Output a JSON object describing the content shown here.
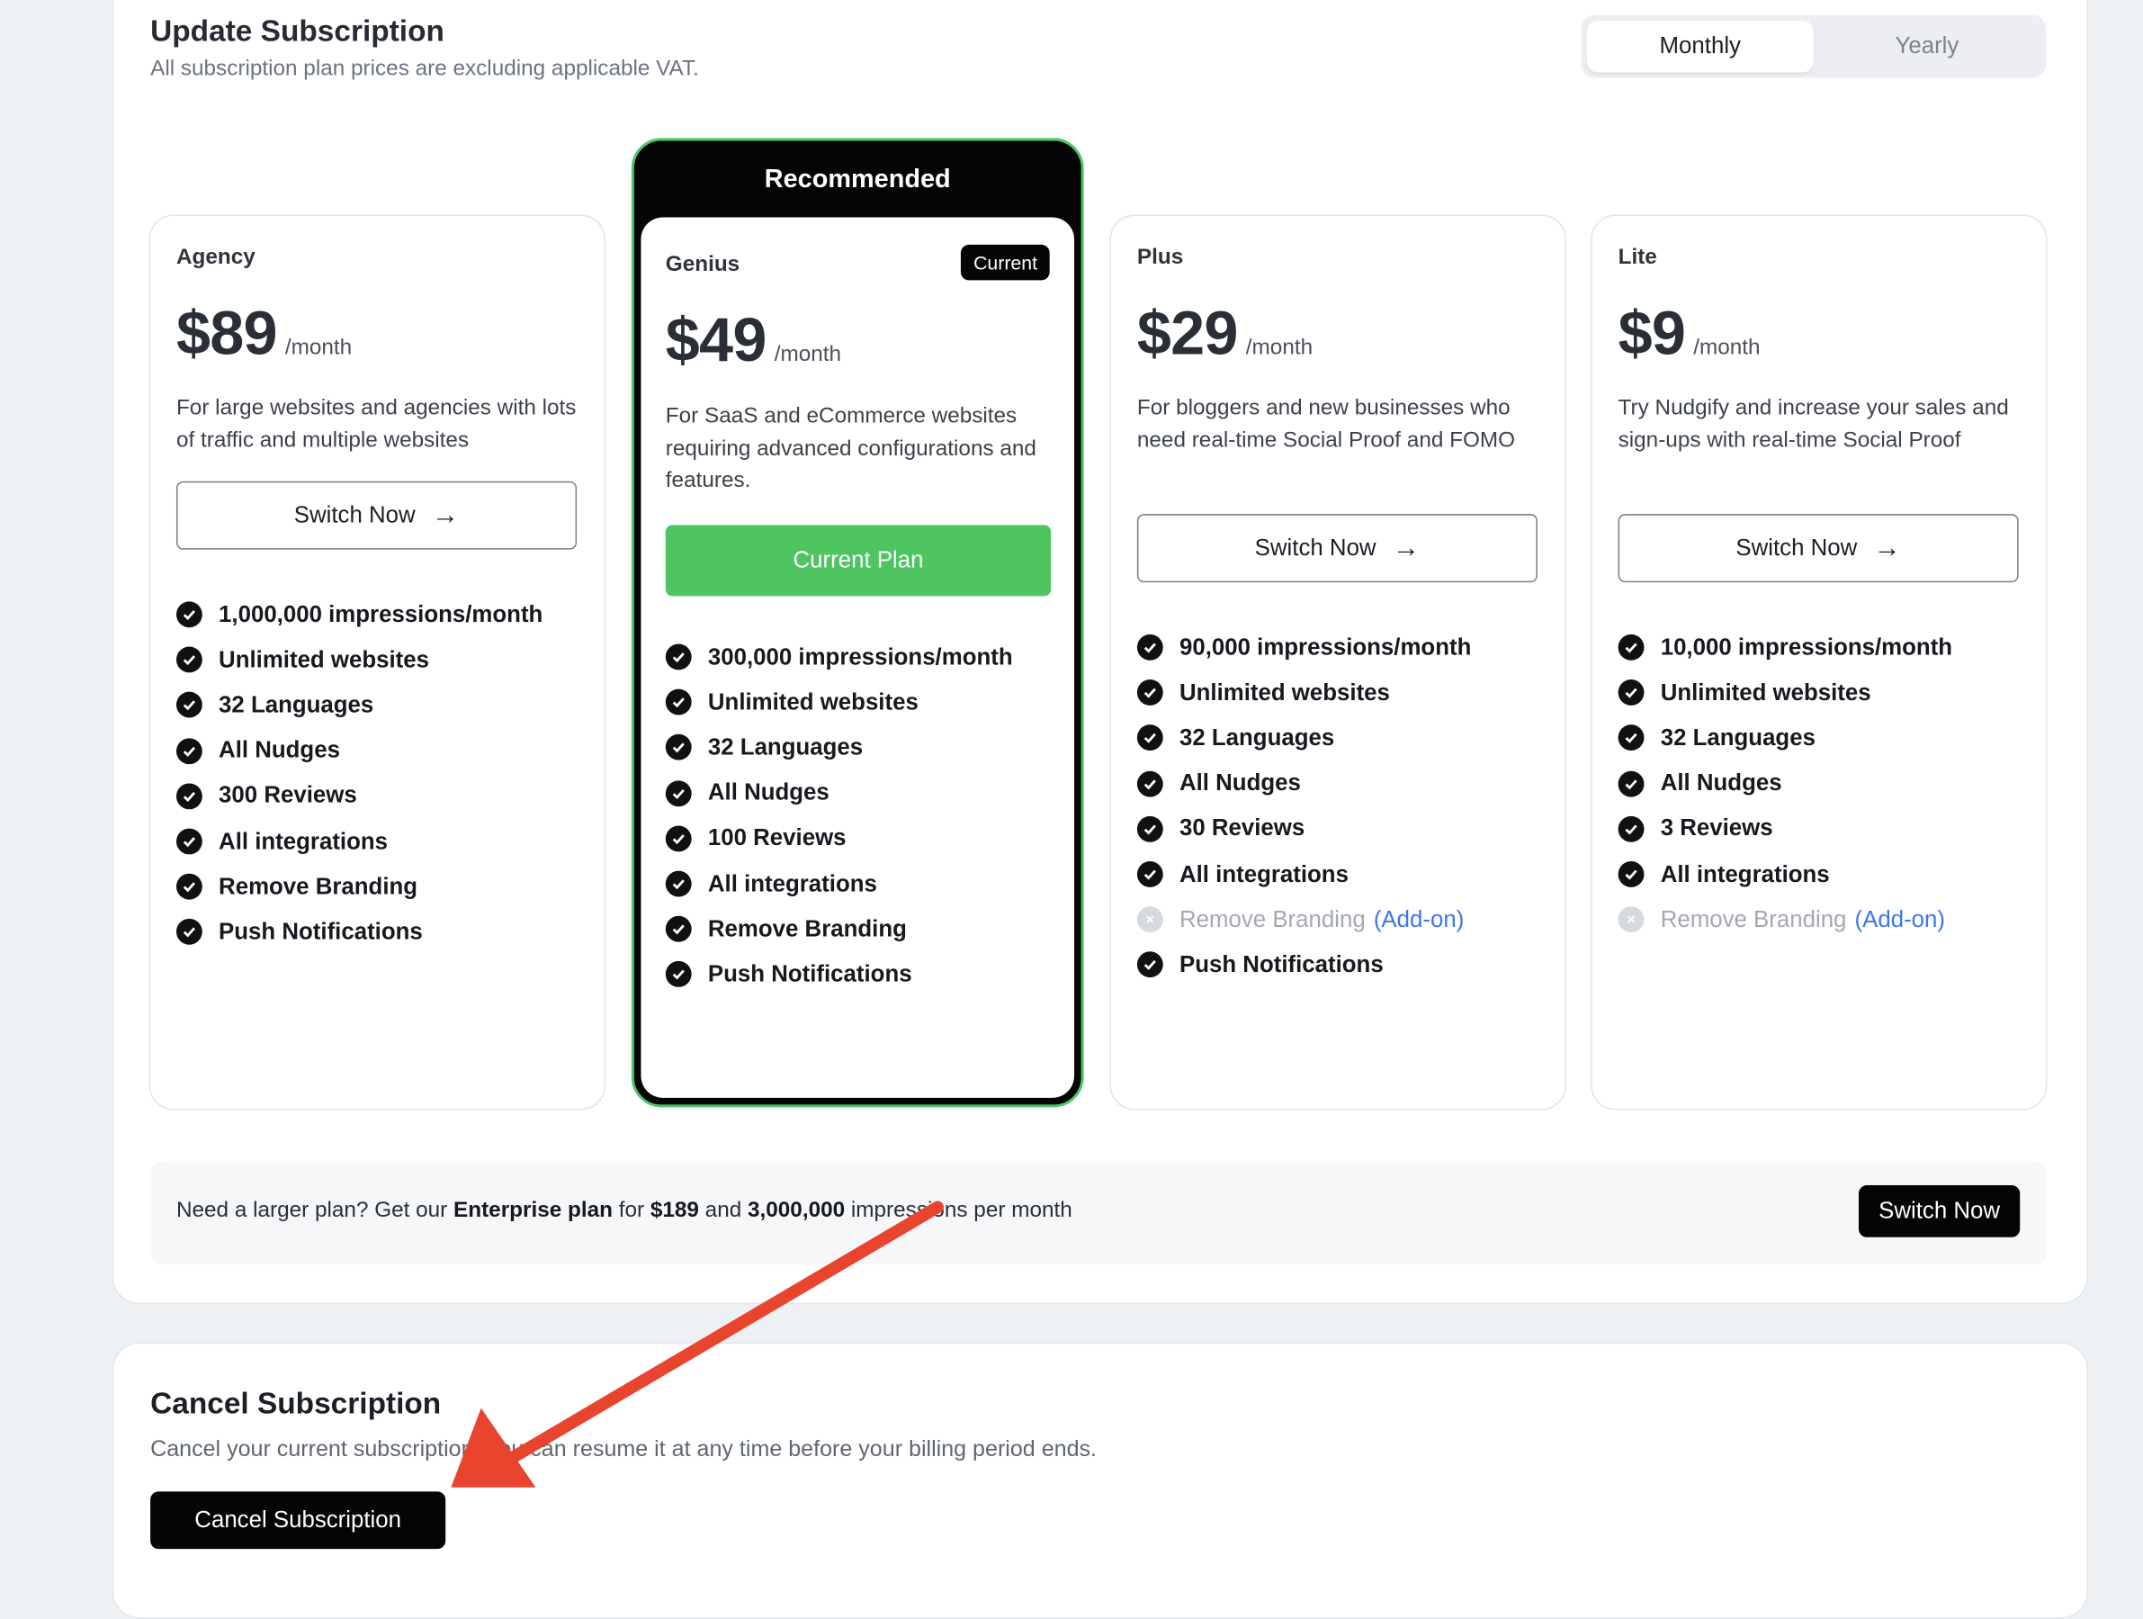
{
  "update": {
    "title": "Update Subscription",
    "subtitle": "All subscription plan prices are excluding applicable VAT.",
    "billing_toggle": {
      "monthly": "Monthly",
      "yearly": "Yearly",
      "selected": "Monthly"
    }
  },
  "plans": {
    "agency": {
      "name": "Agency",
      "price": "$89",
      "period": "/month",
      "description": "For large websites and agencies with lots of traffic and multiple websites",
      "button": "Switch Now",
      "features": [
        "1,000,000 impressions/month",
        "Unlimited websites",
        "32 Languages",
        "All Nudges",
        "300 Reviews",
        "All integrations",
        "Remove Branding",
        "Push Notifications"
      ]
    },
    "genius": {
      "ribbon": "Recommended",
      "name": "Genius",
      "badge": "Current",
      "price": "$49",
      "period": "/month",
      "description": "For SaaS and eCommerce websites requiring advanced configurations and features.",
      "button": "Current Plan",
      "features": [
        "300,000 impressions/month",
        "Unlimited websites",
        "32 Languages",
        "All Nudges",
        "100 Reviews",
        "All integrations",
        "Remove Branding",
        "Push Notifications"
      ]
    },
    "plus": {
      "name": "Plus",
      "price": "$29",
      "period": "/month",
      "description": "For bloggers and new businesses who need real-time Social Proof and FOMO",
      "button": "Switch Now",
      "features": [
        "90,000 impressions/month",
        "Unlimited websites",
        "32 Languages",
        "All Nudges",
        "30 Reviews",
        "All integrations"
      ],
      "disabled_feature": "Remove Branding",
      "addon_label": "(Add-on)",
      "last_feature": "Push Notifications"
    },
    "lite": {
      "name": "Lite",
      "price": "$9",
      "period": "/month",
      "description": "Try Nudgify and increase your sales and sign-ups with real-time Social Proof",
      "button": "Switch Now",
      "features": [
        "10,000 impressions/month",
        "Unlimited websites",
        "32 Languages",
        "All Nudges",
        "3 Reviews",
        "All integrations"
      ],
      "disabled_feature": "Remove Branding",
      "addon_label": "(Add-on)"
    }
  },
  "enterprise": {
    "prefix": "Need a larger plan? Get our ",
    "plan_name": "Enterprise plan",
    "mid": " for ",
    "price": "$189",
    "and": " and ",
    "impressions": "3,000,000",
    "suffix": " impressions per month",
    "button": "Switch Now"
  },
  "cancel": {
    "title": "Cancel Subscription",
    "subtitle": "Cancel your current subscription. You can resume it at any time before your billing period ends.",
    "button": "Cancel Subscription"
  },
  "annotation": {
    "arrow_color": "#e8442e"
  },
  "colors": {
    "accent_green": "#4fc562",
    "addon_blue": "#3c76e8",
    "dark": "#050505"
  }
}
